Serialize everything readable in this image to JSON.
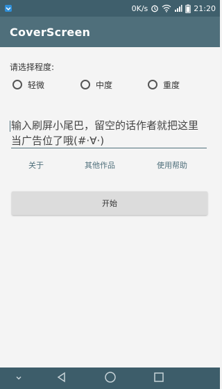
{
  "status_bar": {
    "speed": "0K/s",
    "time": "21:20"
  },
  "app_bar": {
    "title": "CoverScreen"
  },
  "degree": {
    "label": "请选择程度:",
    "options": [
      "轻微",
      "中度",
      "重度"
    ]
  },
  "tail_input": {
    "placeholder": "输入刷屏小尾巴，留空的话作者就把这里当广告位了哦(#·∀·)"
  },
  "links": {
    "about": "关于",
    "other_works": "其他作品",
    "help": "使用帮助"
  },
  "start_button": {
    "label": "开始"
  },
  "colors": {
    "status_bar": "#3f5f6c",
    "app_bar": "#4f6f7b",
    "nav_bar": "#3d5d6a",
    "background": "#f4f4f4",
    "button": "#dcdcdc"
  },
  "icons": {
    "status_left": "notification-icon",
    "alarm": "alarm-icon",
    "wifi": "wifi-icon",
    "signal": "signal-icon",
    "battery": "battery-icon",
    "nav_down": "chevron-down-icon",
    "nav_back": "back-icon",
    "nav_home": "home-icon",
    "nav_recent": "recent-apps-icon"
  }
}
